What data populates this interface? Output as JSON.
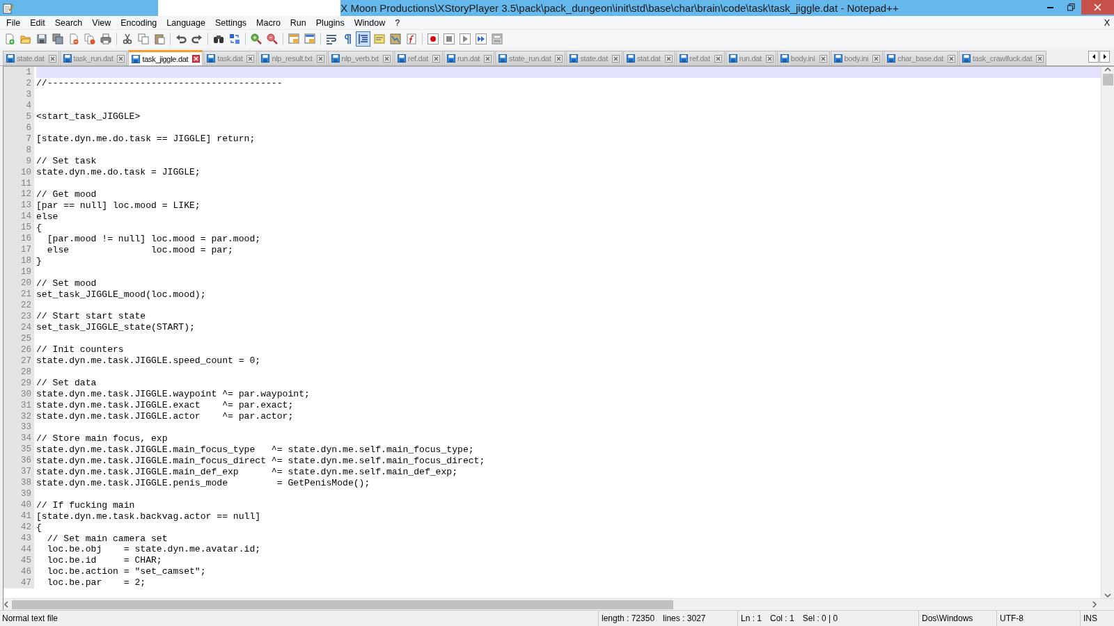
{
  "window": {
    "title": "X Moon Productions\\XStoryPlayer 3.5\\pack\\pack_dungeon\\init\\std\\base\\char\\brain\\code\\task\\task_jiggle.dat - Notepad++",
    "redacted": true
  },
  "menu": {
    "items": [
      "File",
      "Edit",
      "Search",
      "View",
      "Encoding",
      "Language",
      "Settings",
      "Macro",
      "Run",
      "Plugins",
      "Window",
      "?"
    ],
    "close_label": "X"
  },
  "toolbar": [
    {
      "pressed": false
    },
    {
      "pressed": false
    },
    {
      "pressed": false
    },
    {
      "pressed": false
    },
    {
      "pressed": false
    },
    {
      "pressed": false
    },
    {
      "pressed": false
    },
    {
      "pressed": false
    },
    {
      "pressed": false
    },
    {
      "pressed": false
    },
    {
      "pressed": false
    },
    {
      "pressed": false
    },
    {
      "pressed": false
    },
    {
      "pressed": false
    },
    {
      "pressed": false
    },
    {
      "pressed": false
    },
    {
      "pressed": false
    },
    {
      "pressed": false
    },
    {
      "pressed": false
    },
    {
      "pressed": false
    },
    {
      "pressed": true
    },
    {
      "pressed": false
    },
    {
      "pressed": false
    },
    {
      "pressed": false
    },
    {
      "pressed": false
    },
    {
      "pressed": false
    },
    {
      "pressed": false
    },
    {
      "pressed": false
    },
    {
      "pressed": false
    }
  ],
  "tabs": [
    {
      "label": "state.dat",
      "selected": false
    },
    {
      "label": "task_run.dat",
      "selected": false
    },
    {
      "label": "task_jiggle.dat",
      "selected": true
    },
    {
      "label": "task.dat",
      "selected": false
    },
    {
      "label": "nlp_result.txt",
      "selected": false
    },
    {
      "label": "nlp_verb.txt",
      "selected": false
    },
    {
      "label": "ref.dat",
      "selected": false
    },
    {
      "label": "run.dat",
      "selected": false
    },
    {
      "label": "state_run.dat",
      "selected": false
    },
    {
      "label": "state.dat",
      "selected": false
    },
    {
      "label": "stat.dat",
      "selected": false
    },
    {
      "label": "ref.dat",
      "selected": false
    },
    {
      "label": "run.dat",
      "selected": false
    },
    {
      "label": "body.ini",
      "selected": false
    },
    {
      "label": "body.ini",
      "selected": false
    },
    {
      "label": "char_base.dat",
      "selected": false
    },
    {
      "label": "task_crawlfuck.dat",
      "selected": false
    }
  ],
  "editor": {
    "lines": [
      {
        "number": "1",
        "current": true
      },
      {
        "number": "2",
        "text": "//-------------------------------------------",
        "current": false
      },
      {
        "number": "3",
        "current": false
      },
      {
        "number": "4",
        "current": false
      },
      {
        "number": "5",
        "text": "<start_task_JIGGLE>",
        "current": false
      },
      {
        "number": "6",
        "current": false
      },
      {
        "number": "7",
        "text": "[state.dyn.me.do.task == JIGGLE] return;",
        "current": false
      },
      {
        "number": "8",
        "current": false
      },
      {
        "number": "9",
        "text": "// Set task",
        "current": false
      },
      {
        "number": "10",
        "text": "state.dyn.me.do.task = JIGGLE;",
        "current": false
      },
      {
        "number": "11",
        "current": false
      },
      {
        "number": "12",
        "text": "// Get mood",
        "current": false
      },
      {
        "number": "13",
        "text": "[par == null] loc.mood = LIKE;",
        "current": false
      },
      {
        "number": "14",
        "text": "else",
        "current": false
      },
      {
        "number": "15",
        "text": "{",
        "current": false
      },
      {
        "number": "16",
        "text": "  [par.mood != null] loc.mood = par.mood;",
        "current": false
      },
      {
        "number": "17",
        "text": "  else               loc.mood = par;",
        "current": false
      },
      {
        "number": "18",
        "text": "}",
        "current": false
      },
      {
        "number": "19",
        "current": false
      },
      {
        "number": "20",
        "text": "// Set mood",
        "current": false
      },
      {
        "number": "21",
        "text": "set_task_JIGGLE_mood(loc.mood);",
        "current": false
      },
      {
        "number": "22",
        "current": false
      },
      {
        "number": "23",
        "text": "// Start start state",
        "current": false
      },
      {
        "number": "24",
        "text": "set_task_JIGGLE_state(START);",
        "current": false
      },
      {
        "number": "25",
        "current": false
      },
      {
        "number": "26",
        "text": "// Init counters",
        "current": false
      },
      {
        "number": "27",
        "text": "state.dyn.me.task.JIGGLE.speed_count = 0;",
        "current": false
      },
      {
        "number": "28",
        "current": false
      },
      {
        "number": "29",
        "text": "// Set data",
        "current": false
      },
      {
        "number": "30",
        "text": "state.dyn.me.task.JIGGLE.waypoint ^= par.waypoint;",
        "current": false
      },
      {
        "number": "31",
        "text": "state.dyn.me.task.JIGGLE.exact    ^= par.exact;",
        "current": false
      },
      {
        "number": "32",
        "text": "state.dyn.me.task.JIGGLE.actor    ^= par.actor;",
        "current": false
      },
      {
        "number": "33",
        "current": false
      },
      {
        "number": "34",
        "text": "// Store main focus, exp",
        "current": false
      },
      {
        "number": "35",
        "text": "state.dyn.me.task.JIGGLE.main_focus_type   ^= state.dyn.me.self.main_focus_type;",
        "current": false
      },
      {
        "number": "36",
        "text": "state.dyn.me.task.JIGGLE.main_focus_direct ^= state.dyn.me.self.main_focus_direct;",
        "current": false
      },
      {
        "number": "37",
        "text": "state.dyn.me.task.JIGGLE.main_def_exp      ^= state.dyn.me.self.main_def_exp;",
        "current": false
      },
      {
        "number": "38",
        "text": "state.dyn.me.task.JIGGLE.penis_mode         = GetPenisMode();",
        "current": false
      },
      {
        "number": "39",
        "current": false
      },
      {
        "number": "40",
        "text": "// If fucking main",
        "current": false
      },
      {
        "number": "41",
        "text": "[state.dyn.me.task.backvag.actor == null]",
        "current": false
      },
      {
        "number": "42",
        "text": "{",
        "current": false
      },
      {
        "number": "43",
        "text": "  // Set main camera set",
        "current": false
      },
      {
        "number": "44",
        "text": "  loc.be.obj    = state.dyn.me.avatar.id;",
        "current": false
      },
      {
        "number": "45",
        "text": "  loc.be.id     = CHAR;",
        "current": false
      },
      {
        "number": "46",
        "text": "  loc.be.action = \"set_camset\";",
        "current": false
      },
      {
        "number": "47",
        "text": "  loc.be.par    = 2;",
        "current": false
      }
    ]
  },
  "status_bar": {
    "file_type": "Normal text file",
    "length": "length : 72350",
    "lines": "lines : 3027",
    "line": "Ln : 1",
    "column": "Col : 1",
    "selection": "Sel : 0 | 0",
    "eol": "Dos\\Windows",
    "encoding": "UTF-8",
    "mode": "INS"
  }
}
